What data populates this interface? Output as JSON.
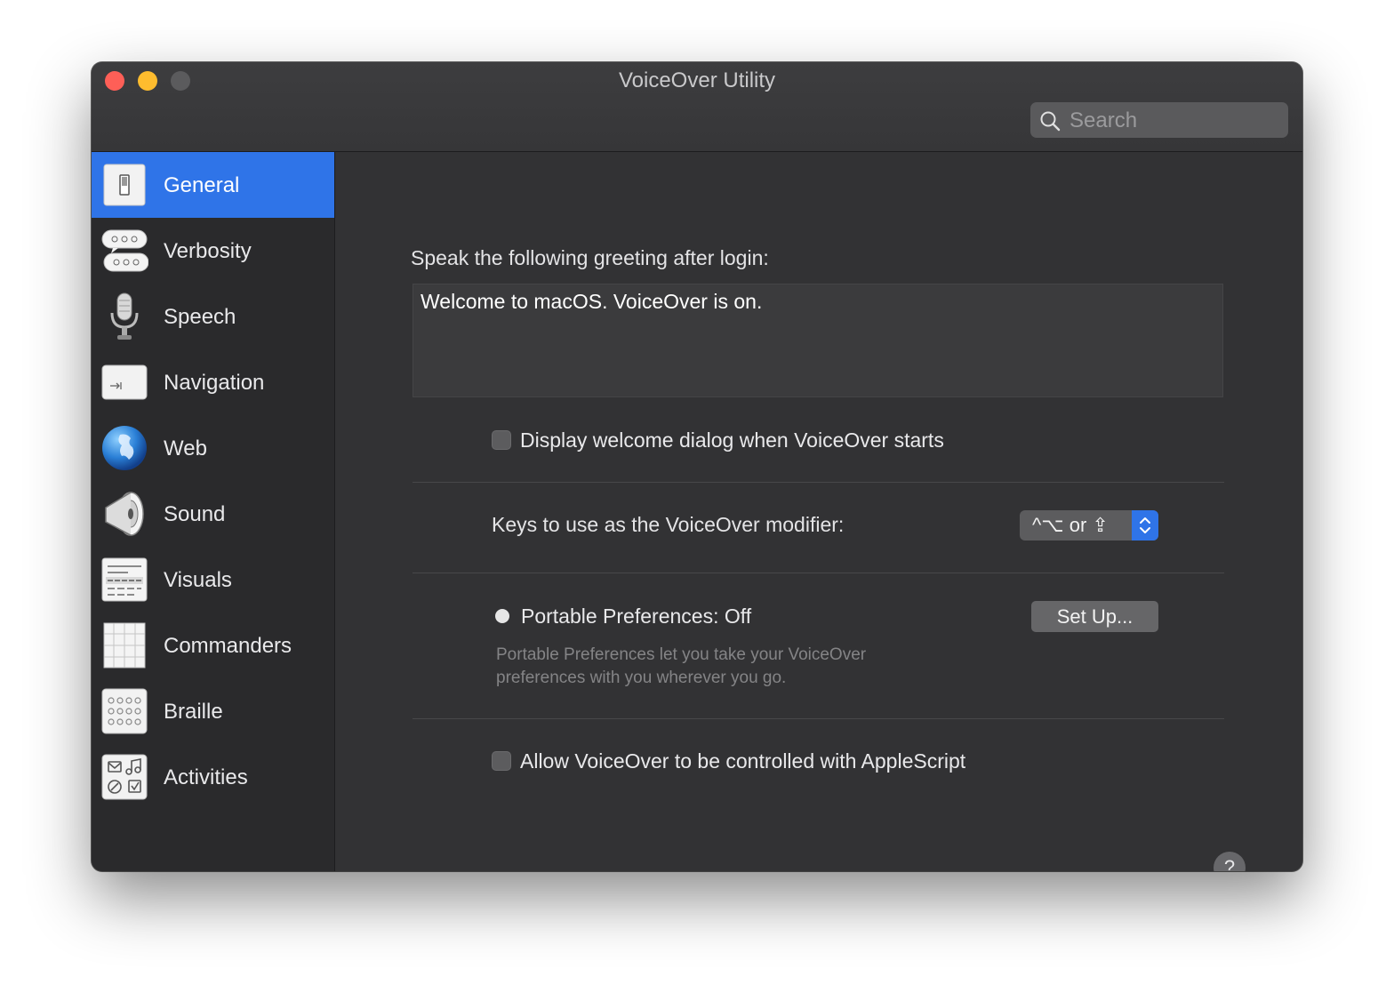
{
  "window": {
    "title": "VoiceOver Utility"
  },
  "search": {
    "placeholder": "Search",
    "icon": "magnifying-glass"
  },
  "sidebar": {
    "items": [
      {
        "label": "General",
        "icon": "switch-panel-icon",
        "selected": true
      },
      {
        "label": "Verbosity",
        "icon": "speech-bubbles-icon",
        "selected": false
      },
      {
        "label": "Speech",
        "icon": "microphone-icon",
        "selected": false
      },
      {
        "label": "Navigation",
        "icon": "tab-key-icon",
        "selected": false
      },
      {
        "label": "Web",
        "icon": "globe-icon",
        "selected": false
      },
      {
        "label": "Sound",
        "icon": "speaker-icon",
        "selected": false
      },
      {
        "label": "Visuals",
        "icon": "text-lines-icon",
        "selected": false
      },
      {
        "label": "Commanders",
        "icon": "grid-icon",
        "selected": false
      },
      {
        "label": "Braille",
        "icon": "braille-dots-icon",
        "selected": false
      },
      {
        "label": "Activities",
        "icon": "activities-icon",
        "selected": false
      }
    ]
  },
  "general": {
    "greeting_label": "Speak the following greeting after login:",
    "greeting_text": "Welcome to macOS. VoiceOver is on.",
    "welcome_dialog_label": "Display welcome dialog when VoiceOver starts",
    "welcome_dialog_checked": false,
    "modifier_label": "Keys to use as the VoiceOver modifier:",
    "modifier_value": "^⌥ or ⇪",
    "portable_label": "Portable Preferences: Off",
    "setup_button": "Set Up...",
    "portable_description": "Portable Preferences let you take your VoiceOver preferences with you wherever you go.",
    "applescript_label": "Allow VoiceOver to be controlled with AppleScript",
    "applescript_checked": false,
    "help_label": "?"
  },
  "colors": {
    "accent": "#2f74e8",
    "window_bg": "#323234",
    "sidebar_bg": "#2a2a2c",
    "close": "#fe5f57",
    "minimize": "#febc2e"
  }
}
